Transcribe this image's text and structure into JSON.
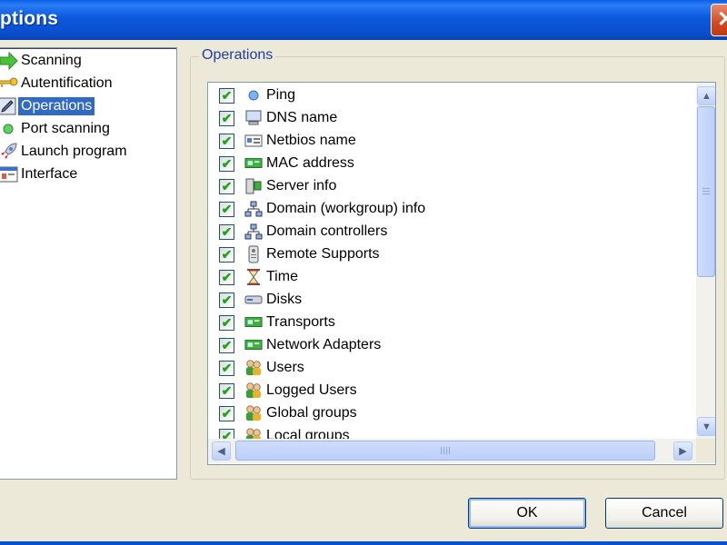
{
  "window": {
    "title": "ptions",
    "close_glyph": "✕"
  },
  "nav": {
    "items": [
      {
        "label": "Scanning",
        "icon": "arrow-right-icon"
      },
      {
        "label": "Autentification",
        "icon": "key-icon"
      },
      {
        "label": "Operations",
        "icon": "pencil-icon",
        "selected": true
      },
      {
        "label": "Port scanning",
        "icon": "green-dot-icon"
      },
      {
        "label": "Launch program",
        "icon": "rocket-icon"
      },
      {
        "label": "Interface",
        "icon": "window-icon"
      }
    ]
  },
  "operations": {
    "group_label": "Operations",
    "items": [
      {
        "label": "Ping",
        "icon": "blue-dot-icon",
        "checked": true
      },
      {
        "label": "DNS name",
        "icon": "computer-icon",
        "checked": true
      },
      {
        "label": "Netbios name",
        "icon": "id-card-icon",
        "checked": true
      },
      {
        "label": "MAC address",
        "icon": "network-card-icon",
        "checked": true
      },
      {
        "label": "Server info",
        "icon": "server-icon",
        "checked": true
      },
      {
        "label": "Domain (workgroup) info",
        "icon": "domain-tree-icon",
        "checked": true
      },
      {
        "label": "Domain controllers",
        "icon": "domain-tree-icon",
        "checked": true
      },
      {
        "label": "Remote Supports",
        "icon": "remote-icon",
        "checked": true
      },
      {
        "label": "Time",
        "icon": "hourglass-icon",
        "checked": true
      },
      {
        "label": "Disks",
        "icon": "disk-icon",
        "checked": true
      },
      {
        "label": "Transports",
        "icon": "network-card-icon",
        "checked": true
      },
      {
        "label": "Network Adapters",
        "icon": "network-card-icon",
        "checked": true
      },
      {
        "label": "Users",
        "icon": "users-icon",
        "checked": true
      },
      {
        "label": "Logged Users",
        "icon": "users-icon",
        "checked": true
      },
      {
        "label": "Global groups",
        "icon": "users-icon",
        "checked": true
      },
      {
        "label": "Local groups",
        "icon": "users-icon",
        "checked": true
      }
    ]
  },
  "buttons": {
    "ok": "OK",
    "cancel": "Cancel"
  },
  "colors": {
    "title_bar": "#0a4fd0",
    "selection": "#316ac5",
    "checkmark": "#21a121",
    "group_label": "#1f3fa0"
  }
}
